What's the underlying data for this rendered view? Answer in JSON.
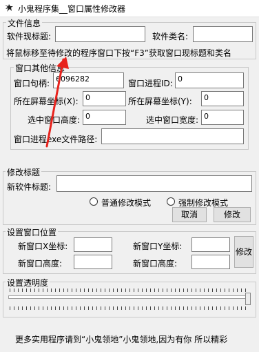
{
  "window": {
    "title": "小鬼程序集__窗口属性修改器",
    "app_icon": "dragon-logo-icon"
  },
  "file_info": {
    "group_title": "文件信息",
    "title_label": "软件现标题:",
    "title_value": "",
    "class_label": "软件类名:",
    "class_value": "",
    "hint": "将鼠标移至待修改的程序窗口下按“F3”获取窗口现标题和类名"
  },
  "other_info": {
    "group_title": "窗口其他信息",
    "handle_label": "窗口句柄:",
    "handle_value": "6096282",
    "pid_label": "窗口进程ID:",
    "pid_value": "0",
    "screen_x_label": "所在屏幕坐标(X):",
    "screen_x_value": "0",
    "screen_y_label": "所在屏幕坐标(Y):",
    "screen_y_value": "0",
    "height_label": "选中窗口高度:",
    "height_value": "0",
    "width_label": "选中窗口宽度:",
    "width_value": "0",
    "exe_path_label": "窗口进程exe文件路径:",
    "exe_path_value": ""
  },
  "modify_title": {
    "group_title": "修改标题",
    "new_title_label": "新软件标题:",
    "new_title_value": "",
    "mode_normal": "普通修改模式",
    "mode_force": "强制修改模式",
    "cancel_label": "取消",
    "modify_label": "修改"
  },
  "position": {
    "group_title": "设置窗口位置",
    "new_x_label": "新窗口X坐标:",
    "new_x_value": "",
    "new_y_label": "新窗口Y坐标:",
    "new_y_value": "",
    "new_height_label": "新窗口高度:",
    "new_height_value": "",
    "new_width_label": "新窗口高度:",
    "new_width_value": "",
    "modify_label": "修改"
  },
  "transparency": {
    "group_title": "设置透明度",
    "level": 1.0
  },
  "footer": {
    "text": "更多实用程序请到“小鬼领地”小鬼领地,因为有你 所以精彩"
  },
  "annotation": {
    "arrow_color": "#e8231d"
  }
}
